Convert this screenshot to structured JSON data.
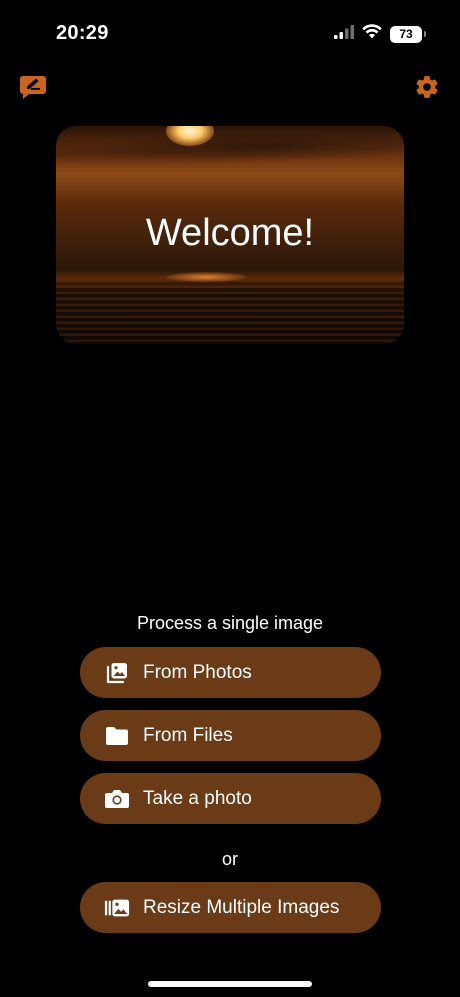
{
  "status_bar": {
    "time": "20:29",
    "battery": "73",
    "icons": [
      "cellular-signal-icon",
      "wifi-icon",
      "battery-icon"
    ]
  },
  "toolbar": {
    "edit_icon": "edit-icon",
    "settings_icon": "gear-icon"
  },
  "hero": {
    "title": "Welcome!"
  },
  "single_section": {
    "label": "Process a single image",
    "buttons": [
      {
        "label": "From Photos",
        "icon": "photo-library-icon"
      },
      {
        "label": "From Files",
        "icon": "folder-icon"
      },
      {
        "label": "Take a photo",
        "icon": "camera-icon"
      }
    ]
  },
  "divider_text": "or",
  "multi_section": {
    "button_label": "Resize Multiple Images",
    "icon": "multiple-images-icon"
  },
  "colors": {
    "background": "#000000",
    "accent": "#c8661f",
    "button": "#6b3a17",
    "text": "#ffffff"
  }
}
